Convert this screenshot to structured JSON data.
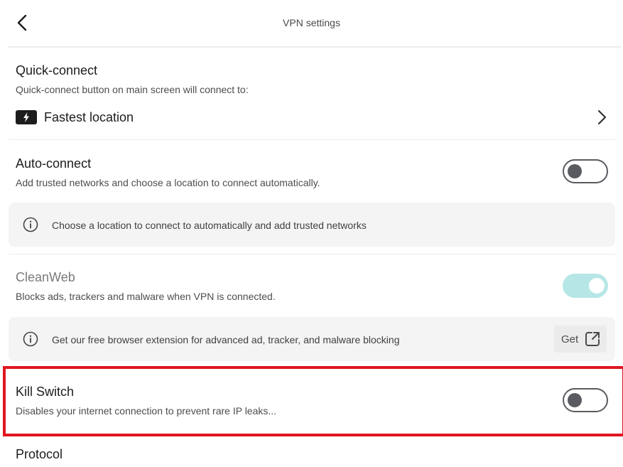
{
  "header": {
    "title": "VPN settings",
    "back_icon": "chevron-left-icon"
  },
  "quick_connect": {
    "title": "Quick-connect",
    "description": "Quick-connect button on main screen will connect to:",
    "selected_location": "Fastest location",
    "location_icon": "lightning-bolt-icon",
    "chevron_icon": "chevron-right-icon"
  },
  "auto_connect": {
    "title": "Auto-connect",
    "description": "Add trusted networks and choose a location to connect automatically.",
    "enabled": false,
    "info_icon": "info-circle-icon",
    "info_text": "Choose a location to connect to automatically and add trusted networks"
  },
  "cleanweb": {
    "title": "CleanWeb",
    "description": "Blocks ads, trackers and malware when VPN is connected.",
    "enabled": true,
    "info_icon": "info-circle-icon",
    "info_text": "Get our free browser extension for advanced ad, tracker, and malware blocking",
    "get_label": "Get",
    "get_icon": "external-link-icon"
  },
  "kill_switch": {
    "title": "Kill Switch",
    "description": "Disables your internet connection to prevent rare IP leaks...",
    "enabled": false
  },
  "protocol": {
    "title": "Protocol"
  },
  "colors": {
    "highlight": "#e0161f",
    "toggle_on": "#b6e6e6",
    "toggle_off": "#595b60",
    "info_bg": "#f4f4f4"
  }
}
